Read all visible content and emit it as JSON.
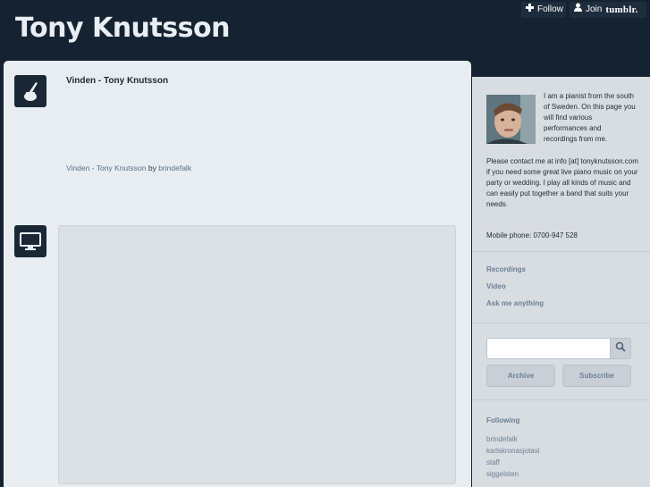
{
  "header": {
    "blog_title": "Tony Knutsson",
    "follow_label": "Follow",
    "join_label": "Join",
    "tumblr_label": "tumblr."
  },
  "posts": {
    "audio": {
      "title": "Vinden - Tony Knutsson",
      "caption_link": "Vinden - Tony Knutsson",
      "caption_by": "by",
      "caption_author": "brindefalk",
      "icon": "ink-pen-icon"
    },
    "video": {
      "icon": "monitor-icon"
    }
  },
  "sidebar": {
    "bio_short": "I am a pianist from the south of Sweden. On this page you will find various performances and recordings from me.",
    "bio_long": "Please contact me at info [at] tonyknutsson.com if you need some great live piano music on your party or wedding. I play all kinds of music and can easily put together a band that suits your needs.",
    "mobile": "Mobile phone: 0700-947 528",
    "nav": [
      "Recordings",
      "Video",
      "Ask me anything"
    ],
    "search_placeholder": "",
    "archive_label": "Archive",
    "subscribe_label": "Subscribe",
    "following_heading": "Following",
    "following": [
      "brindefalk",
      "karlskronasjotaxi",
      "staff",
      "siggelsten"
    ]
  },
  "colors": {
    "background": "#152231",
    "panel": "#e8edf1",
    "sidebar": "#d8dde2",
    "link": "#6b7f93"
  }
}
